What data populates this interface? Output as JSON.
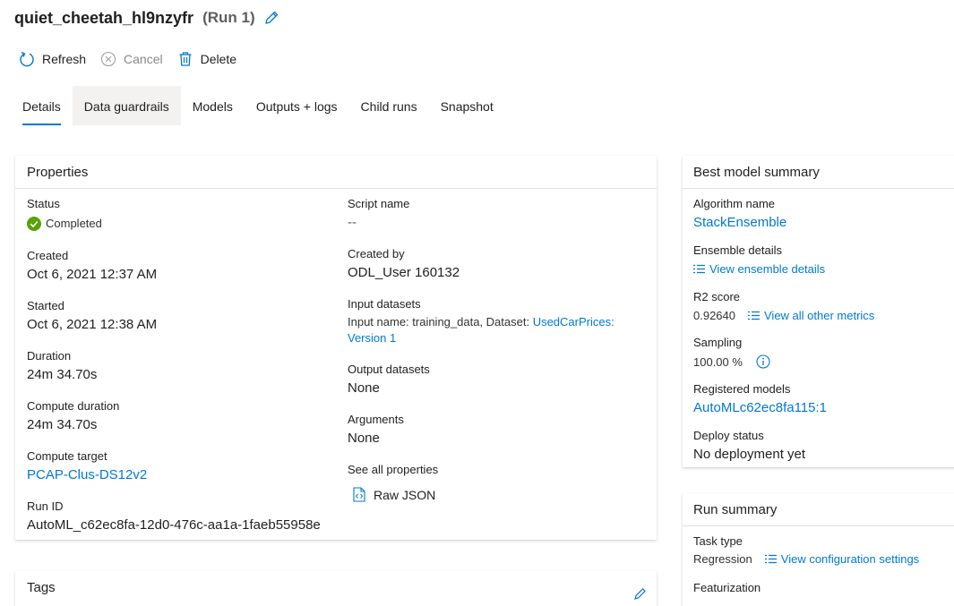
{
  "header": {
    "run_name": "quiet_cheetah_hl9nzyfr",
    "run_number": "(Run 1)"
  },
  "toolbar": {
    "refresh": "Refresh",
    "cancel": "Cancel",
    "delete": "Delete"
  },
  "tabs": [
    {
      "label": "Details",
      "active": true
    },
    {
      "label": "Data guardrails",
      "hovered": true
    },
    {
      "label": "Models"
    },
    {
      "label": "Outputs + logs"
    },
    {
      "label": "Child runs"
    },
    {
      "label": "Snapshot"
    }
  ],
  "properties": {
    "title": "Properties",
    "status": {
      "label": "Status",
      "value": "Completed"
    },
    "created": {
      "label": "Created",
      "value": "Oct 6, 2021 12:37 AM"
    },
    "started": {
      "label": "Started",
      "value": "Oct 6, 2021 12:38 AM"
    },
    "duration": {
      "label": "Duration",
      "value": "24m 34.70s"
    },
    "compute_duration": {
      "label": "Compute duration",
      "value": "24m 34.70s"
    },
    "compute_target": {
      "label": "Compute target",
      "value": "PCAP-Clus-DS12v2"
    },
    "run_id": {
      "label": "Run ID",
      "value": "AutoML_c62ec8fa-12d0-476c-aa1a-1faeb55958e"
    },
    "script_name": {
      "label": "Script name",
      "value": "--"
    },
    "created_by": {
      "label": "Created by",
      "value": "ODL_User 160132"
    },
    "input_datasets": {
      "label": "Input datasets",
      "prefix": "Input name: training_data, Dataset: ",
      "dataset_link": "UsedCarPrices:",
      "version_link": "Version 1"
    },
    "output_datasets": {
      "label": "Output datasets",
      "value": "None"
    },
    "arguments": {
      "label": "Arguments",
      "value": "None"
    },
    "see_all": {
      "label": "See all properties",
      "raw_json": "Raw JSON"
    }
  },
  "tags": {
    "title": "Tags"
  },
  "best_model": {
    "title": "Best model summary",
    "algorithm": {
      "label": "Algorithm name",
      "value": "StackEnsemble"
    },
    "ensemble": {
      "label": "Ensemble details",
      "link": "View ensemble details"
    },
    "r2": {
      "label": "R2 score",
      "value": "0.92640",
      "link": "View all other metrics"
    },
    "sampling": {
      "label": "Sampling",
      "value": "100.00 %"
    },
    "registered": {
      "label": "Registered models",
      "value": "AutoMLc62ec8fa115:1"
    },
    "deploy": {
      "label": "Deploy status",
      "value": "No deployment yet"
    }
  },
  "run_summary": {
    "title": "Run summary",
    "task_type": {
      "label": "Task type",
      "value": "Regression",
      "link": "View configuration settings"
    },
    "featurization": {
      "label": "Featurization"
    }
  },
  "colors": {
    "accent": "#0078d4",
    "success": "#107c10"
  }
}
